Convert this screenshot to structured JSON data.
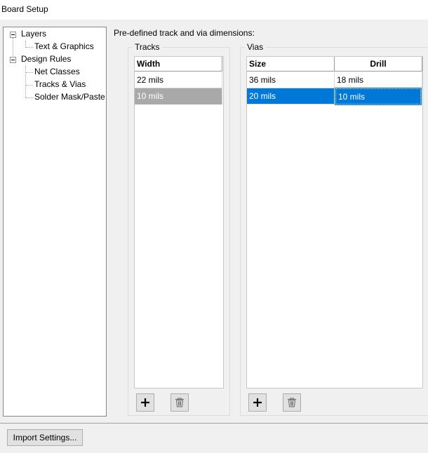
{
  "window": {
    "title": "Board Setup"
  },
  "tree": {
    "items": [
      {
        "label": "Layers"
      },
      {
        "label": "Text & Graphics"
      },
      {
        "label": "Design Rules"
      },
      {
        "label": "Net Classes"
      },
      {
        "label": "Tracks & Vias"
      },
      {
        "label": "Solder Mask/Paste"
      }
    ]
  },
  "panel": {
    "heading": "Pre-defined track and via dimensions:",
    "tracks": {
      "label": "Tracks",
      "columns": [
        "Width"
      ],
      "rows": [
        [
          "22 mils"
        ],
        [
          "10 mils"
        ]
      ]
    },
    "vias": {
      "label": "Vias",
      "columns": [
        "Size",
        "Drill"
      ],
      "rows": [
        [
          "36 mils",
          "18 mils"
        ],
        [
          "20 mils",
          "10 mils"
        ]
      ]
    }
  },
  "footer": {
    "import_label": "Import Settings..."
  },
  "colors": {
    "selection_blue": "#0078d7",
    "selection_gray": "#a9a9a9"
  },
  "icons": {
    "add": "plus-icon",
    "delete": "trash-icon"
  }
}
